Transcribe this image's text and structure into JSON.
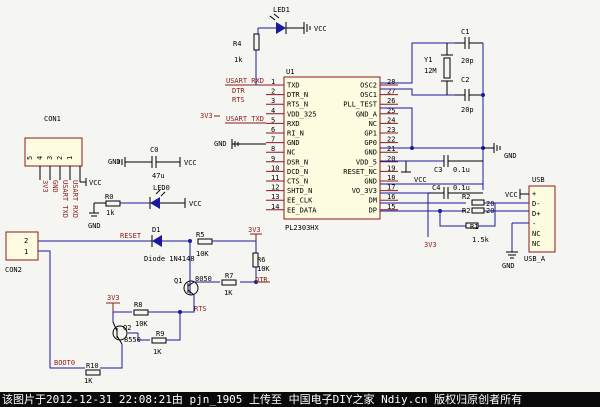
{
  "footer": "该图片于2012-12-31 22:08:21由 pjn_1905 上传至 中国电子DIY之家 Ndiy.cn 版权归原创者所有",
  "ic": {
    "ref": "U1",
    "part": "PL2303HX",
    "left_pins": [
      {
        "num": "1",
        "name": "TXD"
      },
      {
        "num": "2",
        "name": "DTR_N"
      },
      {
        "num": "3",
        "name": "RTS_N"
      },
      {
        "num": "4",
        "name": "VDD_325"
      },
      {
        "num": "5",
        "name": "RXD"
      },
      {
        "num": "6",
        "name": "RI_N"
      },
      {
        "num": "7",
        "name": "GND"
      },
      {
        "num": "8",
        "name": "NC"
      },
      {
        "num": "9",
        "name": "DSR_N"
      },
      {
        "num": "10",
        "name": "DCD_N"
      },
      {
        "num": "11",
        "name": "CTS_N"
      },
      {
        "num": "12",
        "name": "SHTD_N"
      },
      {
        "num": "13",
        "name": "EE_CLK"
      },
      {
        "num": "14",
        "name": "EE_DATA"
      }
    ],
    "right_pins": [
      {
        "num": "28",
        "name": "OSC2"
      },
      {
        "num": "27",
        "name": "OSC1"
      },
      {
        "num": "26",
        "name": "PLL_TEST"
      },
      {
        "num": "25",
        "name": "GND_A"
      },
      {
        "num": "24",
        "name": "NC"
      },
      {
        "num": "23",
        "name": "GP1"
      },
      {
        "num": "22",
        "name": "GP0"
      },
      {
        "num": "21",
        "name": "GND"
      },
      {
        "num": "20",
        "name": "VDD_5"
      },
      {
        "num": "19",
        "name": "RESET_NC"
      },
      {
        "num": "18",
        "name": "GND"
      },
      {
        "num": "17",
        "name": "VO_3V3"
      },
      {
        "num": "16",
        "name": "DM"
      },
      {
        "num": "15",
        "name": "DP"
      }
    ]
  },
  "net_labels": {
    "usart_rxd": "USART RXD",
    "dtr": "DTR",
    "rts": "RTS",
    "v3v3_a": "3V3",
    "usart_txd": "USART TXD",
    "vcc_led1": "VCC",
    "vcc_c0": "VCC",
    "vcc_led0": "VCC",
    "vcc_con1": "VCC",
    "vcc_c3": "VCC",
    "vcc_usb": "VCC",
    "gnd_pin7": "GND",
    "gnd_c0": "GND",
    "gnd_r0": "GND",
    "gnd_right": "GND",
    "gnd_usb": "GND",
    "v3v3_c4": "3V3",
    "v3v3_r6": "3V3",
    "v3v3_q2": "3V3",
    "reset": "RESET",
    "dtr2": "DTR",
    "rts2": "RTS",
    "boot0": "BOOT0"
  },
  "components": {
    "led1": "LED1",
    "r4": "R4",
    "r4_val": "1k",
    "y1": "Y1",
    "y1_val": "12M",
    "c1": "C1",
    "c1_val": "20p",
    "c2": "C2",
    "c2_val": "20p",
    "c3": "C3",
    "c3_val": "0.1u",
    "c4": "C4",
    "c4_val": "0.1u",
    "r1": "R1",
    "r1_val": "1.5k",
    "r2a": "R2",
    "r2a_val": "20",
    "r2b": "R2",
    "r2b_val": "20",
    "usb": "USB",
    "usb_ref": "USB_A",
    "usb_pins": [
      "+",
      "D-",
      "D+",
      "-",
      "NC",
      "NC"
    ],
    "con1": "CON1",
    "con1_pins": [
      "5",
      "4",
      "3",
      "2",
      "1"
    ],
    "con1_nets": [
      "3V3",
      "GND",
      "USART TXD",
      "USART RXD"
    ],
    "c0": "C0",
    "c0_val": "47u",
    "r0": "R0",
    "r0_val": "1k",
    "led0": "LED0",
    "con2": "CON2",
    "con2_pins": [
      "2",
      "1"
    ],
    "d1": "D1",
    "d1_val": "Diode 1N4148",
    "r5": "R5",
    "r5_val": "10K",
    "r6": "R6",
    "r6_val": "10K",
    "q1": "Q1",
    "q1_val": "8050",
    "r7": "R7",
    "r7_val": "1K",
    "q2": "Q2",
    "q2_val": "8550",
    "r8": "R8",
    "r8_val": "10K",
    "r9": "R9",
    "r9_val": "1K",
    "r10": "R10",
    "r10_val": "1K"
  }
}
